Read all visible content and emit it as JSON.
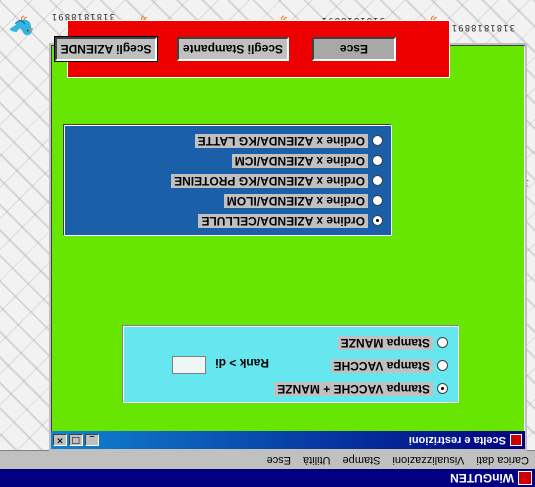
{
  "app": {
    "title": "WinGUTEN"
  },
  "menubar": {
    "items": [
      "Carica dati",
      "Visualizzazioni",
      "Stampe",
      "Utilità",
      "Esce"
    ]
  },
  "dialog": {
    "title": "Scelta e restrizioni",
    "buttons": {
      "minimize": "_",
      "maximize": "□",
      "close": "×"
    },
    "actions": {
      "select_companies": "Scegli AZIENDE",
      "select_printer": "Scegli Stampante",
      "exit": "Esce"
    },
    "order_options": [
      {
        "label": "Ordine x AZIENDA/KG LATTE",
        "checked": false
      },
      {
        "label": "Ordine x AZIENDA/ICM",
        "checked": false
      },
      {
        "label": "Ordine x AZIENDA/KG PROTEINE",
        "checked": false
      },
      {
        "label": "Ordine x AZIENDA/ILOM",
        "checked": false
      },
      {
        "label": "Ordine x AZIENDA/CELLULE",
        "checked": true
      }
    ],
    "print_options": [
      {
        "label": "Stampa  MANZE",
        "checked": false
      },
      {
        "label": "Stampa VACCHE",
        "checked": false
      },
      {
        "label": "Stampa VACCHE + MANZE",
        "checked": true
      }
    ],
    "rank": {
      "label": "Rank > di",
      "value": ""
    }
  },
  "wallpaper": {
    "glyph_text": "3181818891"
  },
  "colors": {
    "dialog_bg": "#66e600",
    "print_group_bg": "#66e6ee",
    "order_group_bg": "#1a5fa8",
    "button_group_bg": "#ee0000",
    "titlebar": "#000080"
  }
}
